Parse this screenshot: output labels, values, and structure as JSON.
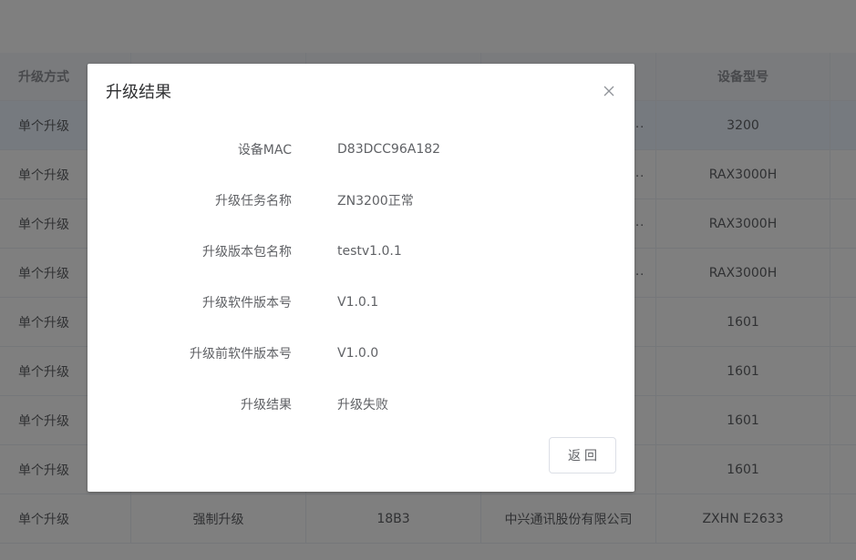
{
  "table": {
    "headers": [
      "升级方式",
      "",
      "",
      "",
      "设备型号",
      ""
    ],
    "rows": [
      [
        "单个升级",
        "",
        "",
        "",
        "3200",
        ""
      ],
      [
        "单个升级",
        "",
        "",
        "",
        "RAX3000H",
        ""
      ],
      [
        "单个升级",
        "",
        "",
        "",
        "RAX3000H",
        ""
      ],
      [
        "单个升级",
        "",
        "",
        "",
        "RAX3000H",
        ""
      ],
      [
        "单个升级",
        "",
        "",
        "",
        "1601",
        ""
      ],
      [
        "单个升级",
        "",
        "",
        "",
        "1601",
        ""
      ],
      [
        "单个升级",
        "",
        "",
        "",
        "1601",
        ""
      ],
      [
        "单个升级",
        "",
        "",
        "",
        "1601",
        ""
      ],
      [
        "单个升级",
        "强制升级",
        "18B3",
        "中兴通讯股份有限公司",
        "ZXHN E2633",
        ""
      ]
    ],
    "ellipsis": ".."
  },
  "dialog": {
    "title": "升级结果",
    "fields": [
      {
        "label": "设备MAC",
        "value": "D83DCC96A182"
      },
      {
        "label": "升级任务名称",
        "value": "ZN3200正常"
      },
      {
        "label": "升级版本包名称",
        "value": "testv1.0.1"
      },
      {
        "label": "升级软件版本号",
        "value": "V1.0.1"
      },
      {
        "label": "升级前软件版本号",
        "value": "V1.0.0"
      },
      {
        "label": "升级结果",
        "value": "升级失败"
      }
    ],
    "back_label": "返回",
    "close_icon": "close-icon"
  }
}
